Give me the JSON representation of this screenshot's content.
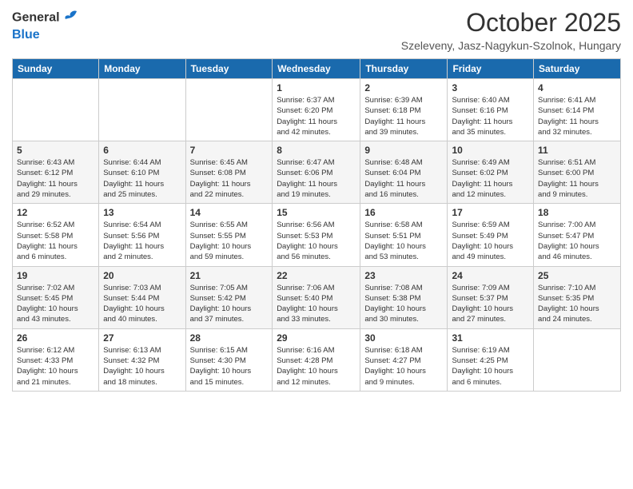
{
  "header": {
    "logo_general": "General",
    "logo_blue": "Blue",
    "month_title": "October 2025",
    "location": "Szeleveny, Jasz-Nagykun-Szolnok, Hungary"
  },
  "weekdays": [
    "Sunday",
    "Monday",
    "Tuesday",
    "Wednesday",
    "Thursday",
    "Friday",
    "Saturday"
  ],
  "weeks": [
    [
      {
        "day": "",
        "info": ""
      },
      {
        "day": "",
        "info": ""
      },
      {
        "day": "",
        "info": ""
      },
      {
        "day": "1",
        "info": "Sunrise: 6:37 AM\nSunset: 6:20 PM\nDaylight: 11 hours\nand 42 minutes."
      },
      {
        "day": "2",
        "info": "Sunrise: 6:39 AM\nSunset: 6:18 PM\nDaylight: 11 hours\nand 39 minutes."
      },
      {
        "day": "3",
        "info": "Sunrise: 6:40 AM\nSunset: 6:16 PM\nDaylight: 11 hours\nand 35 minutes."
      },
      {
        "day": "4",
        "info": "Sunrise: 6:41 AM\nSunset: 6:14 PM\nDaylight: 11 hours\nand 32 minutes."
      }
    ],
    [
      {
        "day": "5",
        "info": "Sunrise: 6:43 AM\nSunset: 6:12 PM\nDaylight: 11 hours\nand 29 minutes."
      },
      {
        "day": "6",
        "info": "Sunrise: 6:44 AM\nSunset: 6:10 PM\nDaylight: 11 hours\nand 25 minutes."
      },
      {
        "day": "7",
        "info": "Sunrise: 6:45 AM\nSunset: 6:08 PM\nDaylight: 11 hours\nand 22 minutes."
      },
      {
        "day": "8",
        "info": "Sunrise: 6:47 AM\nSunset: 6:06 PM\nDaylight: 11 hours\nand 19 minutes."
      },
      {
        "day": "9",
        "info": "Sunrise: 6:48 AM\nSunset: 6:04 PM\nDaylight: 11 hours\nand 16 minutes."
      },
      {
        "day": "10",
        "info": "Sunrise: 6:49 AM\nSunset: 6:02 PM\nDaylight: 11 hours\nand 12 minutes."
      },
      {
        "day": "11",
        "info": "Sunrise: 6:51 AM\nSunset: 6:00 PM\nDaylight: 11 hours\nand 9 minutes."
      }
    ],
    [
      {
        "day": "12",
        "info": "Sunrise: 6:52 AM\nSunset: 5:58 PM\nDaylight: 11 hours\nand 6 minutes."
      },
      {
        "day": "13",
        "info": "Sunrise: 6:54 AM\nSunset: 5:56 PM\nDaylight: 11 hours\nand 2 minutes."
      },
      {
        "day": "14",
        "info": "Sunrise: 6:55 AM\nSunset: 5:55 PM\nDaylight: 10 hours\nand 59 minutes."
      },
      {
        "day": "15",
        "info": "Sunrise: 6:56 AM\nSunset: 5:53 PM\nDaylight: 10 hours\nand 56 minutes."
      },
      {
        "day": "16",
        "info": "Sunrise: 6:58 AM\nSunset: 5:51 PM\nDaylight: 10 hours\nand 53 minutes."
      },
      {
        "day": "17",
        "info": "Sunrise: 6:59 AM\nSunset: 5:49 PM\nDaylight: 10 hours\nand 49 minutes."
      },
      {
        "day": "18",
        "info": "Sunrise: 7:00 AM\nSunset: 5:47 PM\nDaylight: 10 hours\nand 46 minutes."
      }
    ],
    [
      {
        "day": "19",
        "info": "Sunrise: 7:02 AM\nSunset: 5:45 PM\nDaylight: 10 hours\nand 43 minutes."
      },
      {
        "day": "20",
        "info": "Sunrise: 7:03 AM\nSunset: 5:44 PM\nDaylight: 10 hours\nand 40 minutes."
      },
      {
        "day": "21",
        "info": "Sunrise: 7:05 AM\nSunset: 5:42 PM\nDaylight: 10 hours\nand 37 minutes."
      },
      {
        "day": "22",
        "info": "Sunrise: 7:06 AM\nSunset: 5:40 PM\nDaylight: 10 hours\nand 33 minutes."
      },
      {
        "day": "23",
        "info": "Sunrise: 7:08 AM\nSunset: 5:38 PM\nDaylight: 10 hours\nand 30 minutes."
      },
      {
        "day": "24",
        "info": "Sunrise: 7:09 AM\nSunset: 5:37 PM\nDaylight: 10 hours\nand 27 minutes."
      },
      {
        "day": "25",
        "info": "Sunrise: 7:10 AM\nSunset: 5:35 PM\nDaylight: 10 hours\nand 24 minutes."
      }
    ],
    [
      {
        "day": "26",
        "info": "Sunrise: 6:12 AM\nSunset: 4:33 PM\nDaylight: 10 hours\nand 21 minutes."
      },
      {
        "day": "27",
        "info": "Sunrise: 6:13 AM\nSunset: 4:32 PM\nDaylight: 10 hours\nand 18 minutes."
      },
      {
        "day": "28",
        "info": "Sunrise: 6:15 AM\nSunset: 4:30 PM\nDaylight: 10 hours\nand 15 minutes."
      },
      {
        "day": "29",
        "info": "Sunrise: 6:16 AM\nSunset: 4:28 PM\nDaylight: 10 hours\nand 12 minutes."
      },
      {
        "day": "30",
        "info": "Sunrise: 6:18 AM\nSunset: 4:27 PM\nDaylight: 10 hours\nand 9 minutes."
      },
      {
        "day": "31",
        "info": "Sunrise: 6:19 AM\nSunset: 4:25 PM\nDaylight: 10 hours\nand 6 minutes."
      },
      {
        "day": "",
        "info": ""
      }
    ]
  ]
}
